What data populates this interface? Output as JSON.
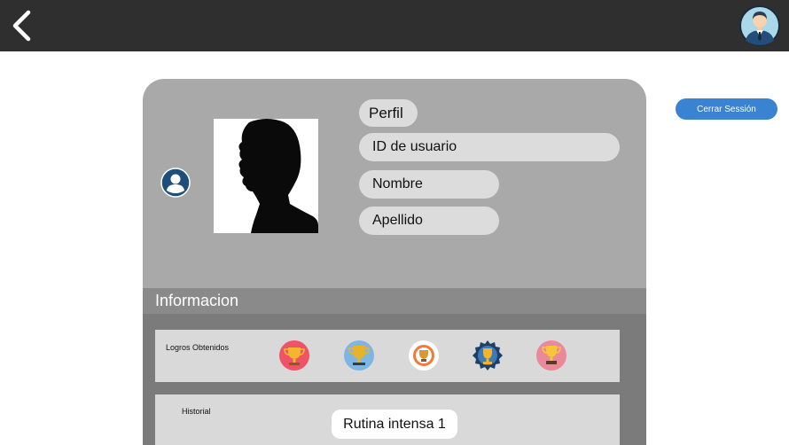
{
  "header": {
    "back_icon": "chevron-left-icon",
    "avatar_icon": "user-avatar-icon"
  },
  "logout_label": "Cerrar Sessión",
  "colors": {
    "topbar": "#2f2f2f",
    "accent": "#3a82d2",
    "card": "#a9a9a9",
    "section_bar": "#8a8a8a",
    "section_body": "#7b7b7b",
    "field": "#dcdcdc"
  },
  "profile": {
    "title": "Perfil",
    "fields": [
      "ID de usuario",
      "Nombre",
      "Apellido"
    ]
  },
  "info": {
    "title": "Informacion",
    "achievements": {
      "label": "Logros Obtenidos",
      "badges": [
        "trophy-red-badge",
        "trophy-blue-badge",
        "trophy-white-badge",
        "trophy-seal-badge",
        "trophy-pink-badge"
      ]
    },
    "history": {
      "label": "Historial",
      "items": [
        "Rutina intensa 1"
      ]
    }
  }
}
